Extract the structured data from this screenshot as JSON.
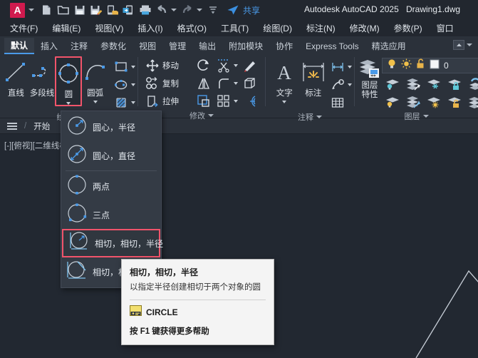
{
  "titlebar": {
    "logo": "A",
    "app_title": "Autodesk AutoCAD 2025",
    "document": "Drawing1.dwg",
    "share_label": "共享",
    "quick_access": [
      {
        "name": "new-file-icon",
        "label": "新建"
      },
      {
        "name": "open-file-icon",
        "label": "打开"
      },
      {
        "name": "save-icon",
        "label": "保存"
      },
      {
        "name": "save-as-icon",
        "label": "另存为"
      },
      {
        "name": "save-to-web-icon",
        "label": "保存到Web"
      },
      {
        "name": "open-from-web-icon",
        "label": "从Web打开"
      },
      {
        "name": "plot-icon",
        "label": "打印"
      },
      {
        "name": "undo-icon",
        "label": "放弃"
      },
      {
        "name": "redo-icon",
        "label": "重做"
      }
    ]
  },
  "menubar": {
    "items": [
      {
        "label": "文件(F)"
      },
      {
        "label": "编辑(E)"
      },
      {
        "label": "视图(V)"
      },
      {
        "label": "插入(I)"
      },
      {
        "label": "格式(O)"
      },
      {
        "label": "工具(T)"
      },
      {
        "label": "绘图(D)"
      },
      {
        "label": "标注(N)"
      },
      {
        "label": "修改(M)"
      },
      {
        "label": "参数(P)"
      },
      {
        "label": "窗口"
      }
    ]
  },
  "ribbon_tabs": {
    "items": [
      {
        "label": "默认",
        "active": true
      },
      {
        "label": "插入",
        "active": false
      },
      {
        "label": "注释",
        "active": false
      },
      {
        "label": "参数化",
        "active": false
      },
      {
        "label": "视图",
        "active": false
      },
      {
        "label": "管理",
        "active": false
      },
      {
        "label": "输出",
        "active": false
      },
      {
        "label": "附加模块",
        "active": false
      },
      {
        "label": "协作",
        "active": false
      },
      {
        "label": "Express Tools",
        "active": false
      },
      {
        "label": "精选应用",
        "active": false
      }
    ]
  },
  "ribbon": {
    "draw_panel": {
      "title": "绘图",
      "line": "直线",
      "polyline": "多段线",
      "circle": "圆",
      "arc": "圆弧",
      "rectangle_icon": "rectangle-icon",
      "ellipse_icon": "ellipse-icon",
      "hatch_icon": "hatch-icon"
    },
    "modify_panel": {
      "title": "修改",
      "move": "移动",
      "copy": "复制",
      "stretch": "拉伸",
      "rotate_icon": "rotate-icon",
      "mirror_icon": "mirror-icon",
      "scale_icon": "scale-icon",
      "trim_icon": "trim-icon",
      "fillet_icon": "fillet-icon",
      "array_icon": "array-icon",
      "erase_icon": "erase-icon",
      "explode_icon": "explode-icon",
      "offset_icon": "offset-icon"
    },
    "annotation_panel": {
      "title": "注释",
      "text": "文字",
      "dimension": "标注",
      "linear_icon": "linear-dimension-icon",
      "leader_icon": "leader-icon",
      "table_icon": "table-icon"
    },
    "layer_panel": {
      "title": "图层",
      "layer_properties_line1": "图层",
      "layer_properties_line2": "特性",
      "current_layer": "0",
      "state_icons": [
        "lightbulb-icon",
        "sun-icon",
        "unlock-icon",
        "color-swatch-icon"
      ]
    }
  },
  "doctabs": {
    "menu_icon": "hamburger-icon",
    "start_tab": "开始",
    "separator": "/"
  },
  "canvas": {
    "viewport_label": "[-][俯视][二维线框]"
  },
  "circle_dropdown": {
    "items": [
      {
        "label": "圆心，半径",
        "icon": "circle-center-radius-icon",
        "highlighted": false
      },
      {
        "label": "圆心，直径",
        "icon": "circle-center-diameter-icon",
        "highlighted": false
      },
      {
        "label": "两点",
        "icon": "circle-2point-icon",
        "highlighted": false
      },
      {
        "label": "三点",
        "icon": "circle-3point-icon",
        "highlighted": false
      },
      {
        "label": "相切，相切，半径",
        "icon": "circle-ttr-icon",
        "highlighted": true
      },
      {
        "label": "相切，相切，相切",
        "icon": "circle-ttt-icon",
        "highlighted": false
      }
    ]
  },
  "tooltip": {
    "title": "相切，相切，半径",
    "description": "以指定半径创建相切于两个对象的圆",
    "command": "CIRCLE",
    "command_icon": "circle-command-icon",
    "help": "按 F1 键获得更多帮助"
  },
  "colors": {
    "accent": "#4a9ae8",
    "highlight_border": "#f2546b",
    "logo": "#d01a4e",
    "canvas_bg": "#222831",
    "ribbon_bg": "#2b313a",
    "chrome_bg": "#22272f"
  }
}
